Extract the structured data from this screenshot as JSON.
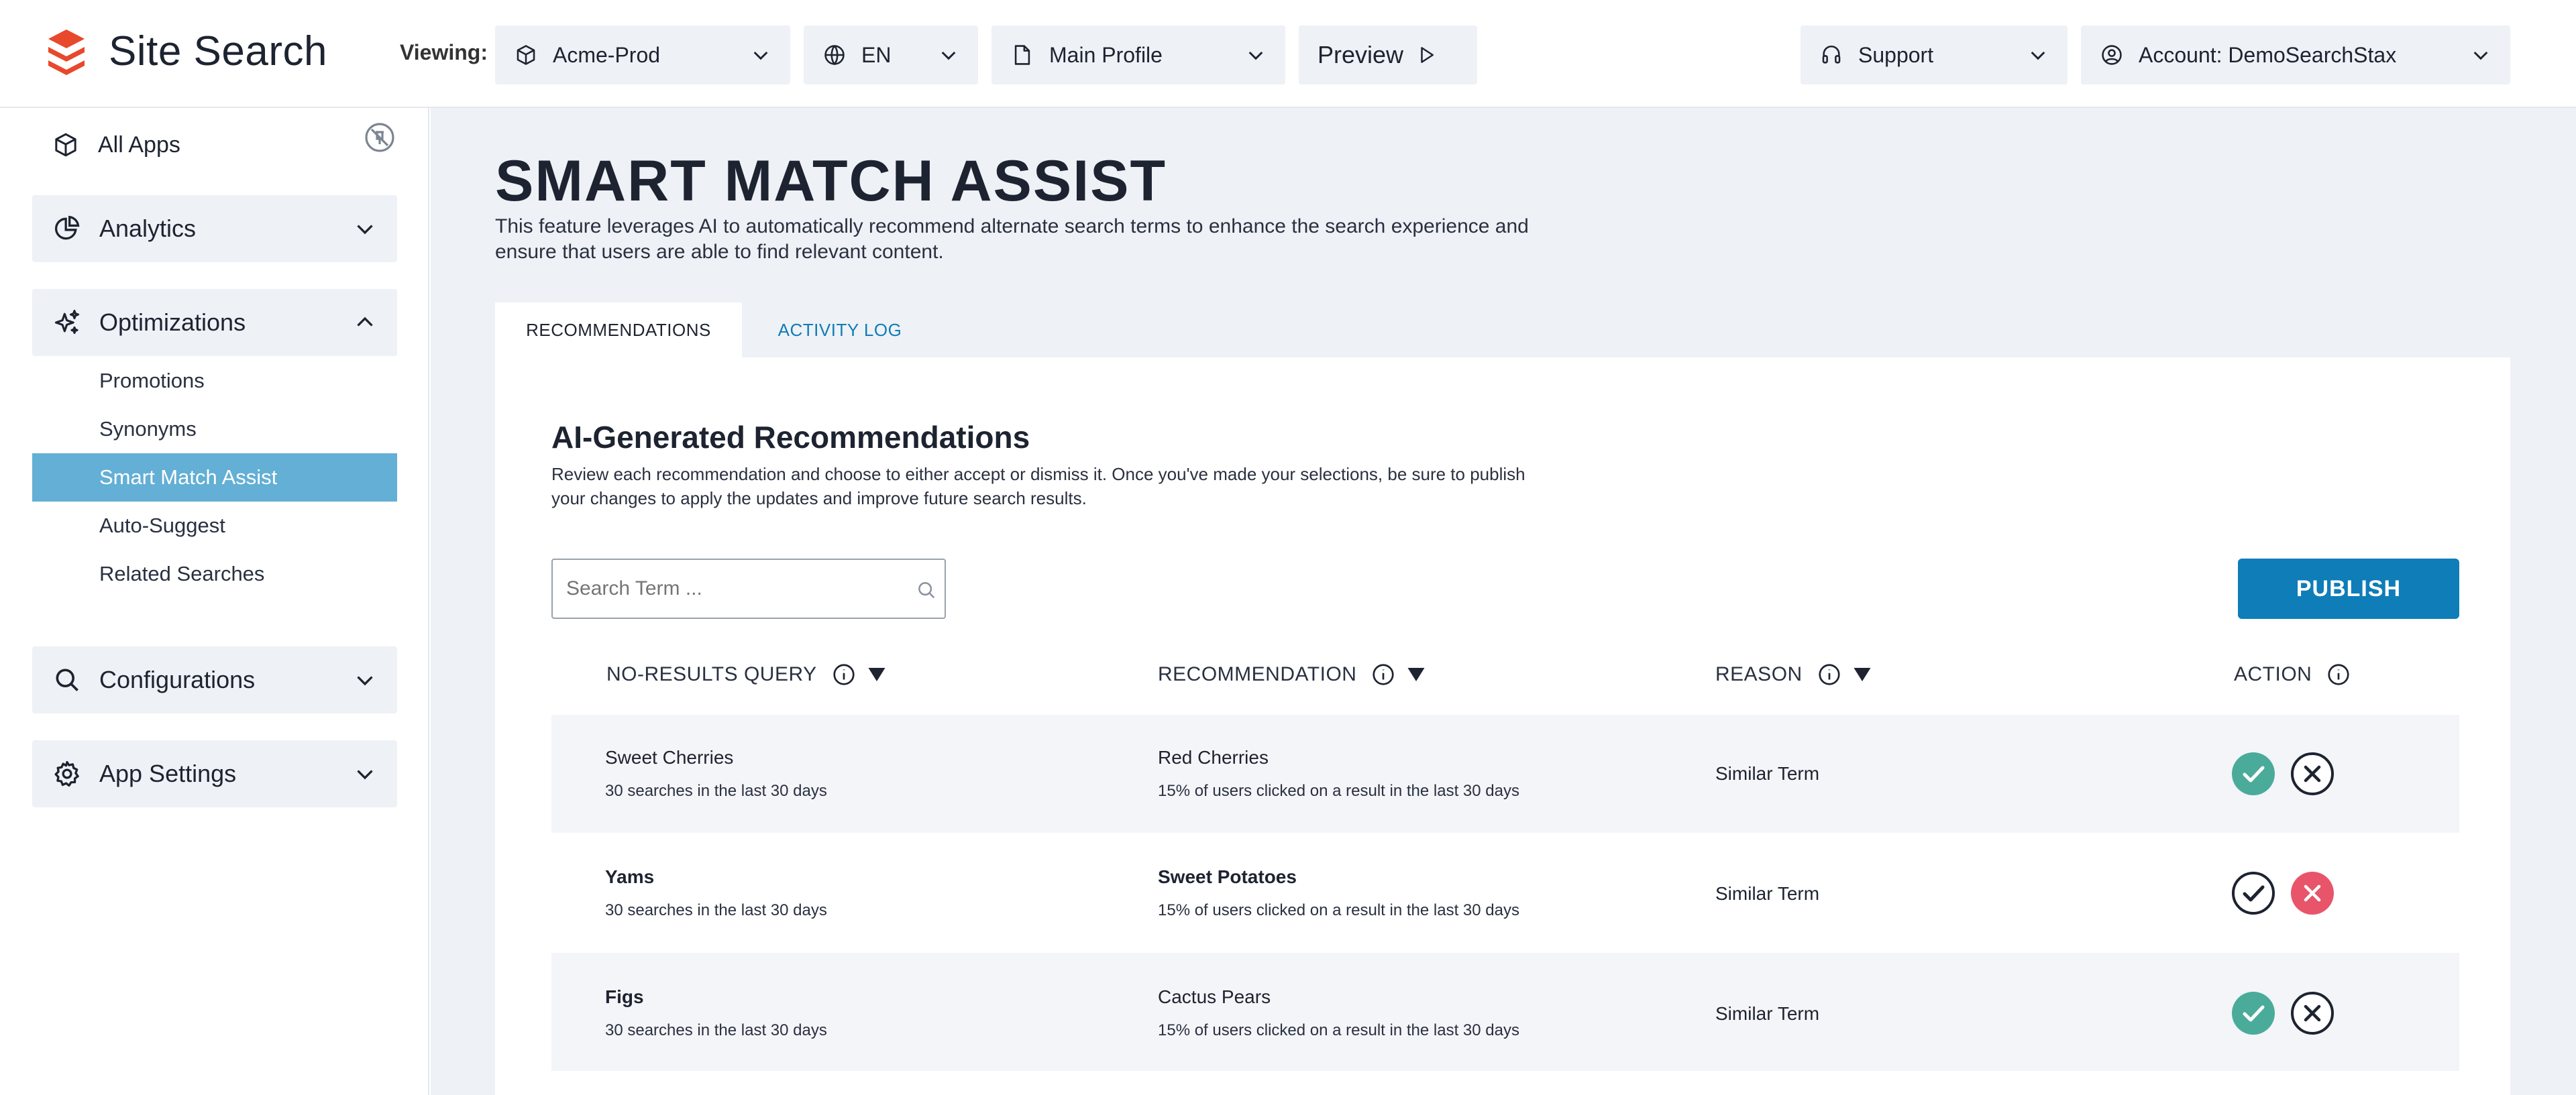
{
  "header": {
    "brand": "Site Search",
    "viewing_label": "Viewing:",
    "app_select": "Acme-Prod",
    "lang_select": "EN",
    "profile_select": "Main Profile",
    "preview_label": "Preview",
    "support_label": "Support",
    "account_label": "Account: DemoSearchStax"
  },
  "sidebar": {
    "all_apps": "All Apps",
    "analytics": "Analytics",
    "optimizations": "Optimizations",
    "sub_items": [
      "Promotions",
      "Synonyms",
      "Smart Match Assist",
      "Auto-Suggest",
      "Related Searches"
    ],
    "configurations": "Configurations",
    "app_settings": "App Settings"
  },
  "main": {
    "title": "SMART MATCH ASSIST",
    "description": "This feature leverages AI to automatically recommend alternate search terms to enhance the search experience and ensure that users are able to find relevant content.",
    "tabs": [
      "RECOMMENDATIONS",
      "ACTIVITY LOG"
    ],
    "section_title": "AI-Generated Recommendations",
    "section_desc": "Review each recommendation and choose to either accept or dismiss it. Once you've made your selections, be sure to publish your changes to apply the updates and improve future search results.",
    "search_placeholder": "Search Term ...",
    "publish_label": "PUBLISH",
    "columns": [
      "NO-RESULTS QUERY",
      "RECOMMENDATION",
      "REASON",
      "ACTION"
    ],
    "rows": [
      {
        "query": "Sweet Cherries",
        "query_sub": "30 searches in the last 30 days",
        "rec": "Red Cherries",
        "rec_sub": "15% of users clicked on a result in the last 30 days",
        "reason": "Similar Term",
        "state": "accepted"
      },
      {
        "query": "Yams",
        "query_sub": "30 searches in the last 30 days",
        "rec": "Sweet Potatoes",
        "rec_sub": "15% of users clicked on a result in the last 30 days",
        "reason": "Similar Term",
        "state": "dismissed"
      },
      {
        "query": "Figs",
        "query_sub": "30 searches in the last 30 days",
        "rec": "Cactus Pears",
        "rec_sub": "15% of users clicked on a result in the last 30 days",
        "reason": "Similar Term",
        "state": "accepted"
      }
    ]
  },
  "colors": {
    "accent": "#0f7db7",
    "active_nav": "#63afd5",
    "accept": "#4aab9b",
    "dismiss": "#e8556a",
    "brand": "#e8482c"
  }
}
